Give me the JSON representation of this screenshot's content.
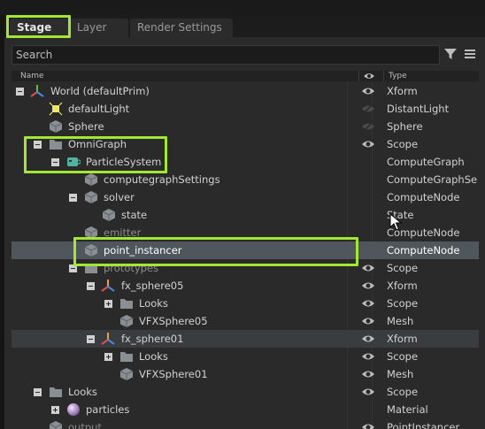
{
  "tabs": {
    "stage": "Stage",
    "layer": "Layer",
    "render_settings": "Render Settings"
  },
  "search": {
    "placeholder": "Search"
  },
  "header": {
    "name": "Name",
    "type": "Type"
  },
  "rows": [
    {
      "label": "World (defaultPrim)",
      "type": "Xform",
      "icon": "xform-icon",
      "visible": true
    },
    {
      "label": "defaultLight",
      "type": "DistantLight",
      "icon": "light-icon",
      "visible": false
    },
    {
      "label": "Sphere",
      "type": "Sphere",
      "icon": "cube-icon",
      "visible": false
    },
    {
      "label": "OmniGraph",
      "type": "Scope",
      "icon": "folder-icon",
      "visible": true
    },
    {
      "label": "ParticleSystem",
      "type": "ComputeGraph",
      "icon": "graph-icon",
      "visible": null
    },
    {
      "label": "computegraphSettings",
      "type": "ComputeGraphSe",
      "icon": "cube-icon",
      "visible": null
    },
    {
      "label": "solver",
      "type": "ComputeNode",
      "icon": "cube-icon",
      "visible": null
    },
    {
      "label": "state",
      "type": "State",
      "icon": "cube-icon",
      "visible": null
    },
    {
      "label": "emitter",
      "type": "ComputeNode",
      "icon": "cube-icon",
      "visible": null
    },
    {
      "label": "point_instancer",
      "type": "ComputeNode",
      "icon": "cube-icon",
      "visible": null
    },
    {
      "label": "prototypes",
      "type": "Scope",
      "icon": "folder-icon",
      "visible": true
    },
    {
      "label": "fx_sphere05",
      "type": "Xform",
      "icon": "xform-icon",
      "visible": true
    },
    {
      "label": "Looks",
      "type": "Scope",
      "icon": "folder-icon",
      "visible": true
    },
    {
      "label": "VFXSphere05",
      "type": "Mesh",
      "icon": "cube-icon",
      "visible": true
    },
    {
      "label": "fx_sphere01",
      "type": "Xform",
      "icon": "xform-icon",
      "visible": true
    },
    {
      "label": "Looks",
      "type": "Scope",
      "icon": "folder-icon",
      "visible": true
    },
    {
      "label": "VFXSphere01",
      "type": "Mesh",
      "icon": "cube-icon",
      "visible": true
    },
    {
      "label": "Looks",
      "type": "Scope",
      "icon": "folder-icon",
      "visible": true
    },
    {
      "label": "particles",
      "type": "Material",
      "icon": "material-icon",
      "visible": null
    },
    {
      "label": "output",
      "type": "PointInstancer",
      "icon": "cube-icon",
      "visible": true
    }
  ],
  "colors": {
    "highlight": "#a3e635",
    "selected_row": "#50575c",
    "accent_icon": "#4fb3a0"
  }
}
